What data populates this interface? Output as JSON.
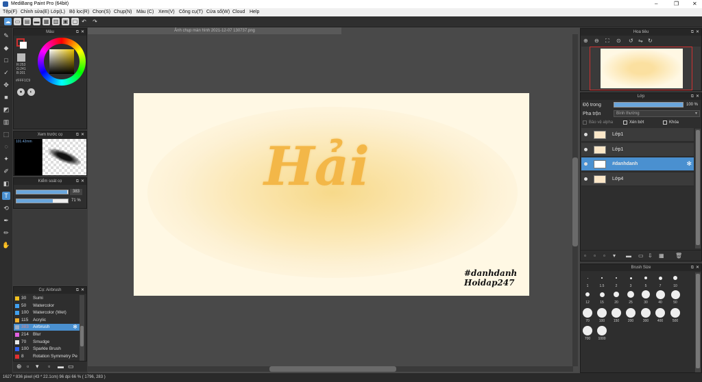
{
  "window": {
    "title": "MediBang Paint Pro (64bit)",
    "controls": [
      "–",
      "❐",
      "✕"
    ]
  },
  "menu": [
    "Tệp(F)",
    "Chỉnh sửa(E)",
    "Lớp(L)",
    "Bộ lọc(R)",
    "Chọn(S)",
    "Chụp(N)",
    "Màu (C)",
    "Xem(V)",
    "Công cụ(T)",
    "Cửa sổ(W)",
    "Cloud",
    "Help"
  ],
  "canvas": {
    "tab_title": "Ảnh chụp màn hình 2021-12-07 130737.png",
    "art_text": "Hải",
    "tag_line1": "#danhdanh",
    "tag_line2": "Hoidap247"
  },
  "color_panel": {
    "title": "Màu",
    "r": "R:253",
    "g": "G:241",
    "b": "B:201",
    "hex": "#FFF1C9",
    "fg": "#f8d9c3",
    "bg": "#ffffff"
  },
  "brush_preview": {
    "title": "Xem trước cọ",
    "size": "101.42mm"
  },
  "brush_control": {
    "title": "Kiểm soát cọ",
    "size_value": "383",
    "opacity_value": "71 %",
    "size_fraction": 0.98,
    "opacity_fraction": 0.71
  },
  "brush_list": {
    "title": "Cọ: Airbrush",
    "items": [
      {
        "size": "30",
        "name": "Sumi",
        "color": "#f0c020"
      },
      {
        "size": "50",
        "name": "Watercolor",
        "color": "#40a0f0"
      },
      {
        "size": "100",
        "name": "Watercolor (Wet)",
        "color": "#40a0f0"
      },
      {
        "size": "115",
        "name": "Acrylic",
        "color": "#f0b030"
      },
      {
        "size": "383",
        "name": "Airbrush",
        "color": "#9fb0c8"
      },
      {
        "size": "214",
        "name": "Blur",
        "color": "#e060e0"
      },
      {
        "size": "70",
        "name": "Smudge",
        "color": "#e8e8e8"
      },
      {
        "size": "100",
        "name": "Sparkle Brush",
        "color": "#3060f0"
      },
      {
        "size": "8",
        "name": "Rotation Symmetry Pe",
        "color": "#e03030"
      }
    ]
  },
  "navigator": {
    "title": "Hoa tiêu"
  },
  "layers": {
    "title": "Lớp",
    "opacity_label": "Độ trong",
    "opacity_value": "100 %",
    "opacity_fraction": 1.0,
    "blend_label": "Pha trộn",
    "blend_value": "Bình thường",
    "protect_alpha": "Bảo vệ alpha",
    "clipping": "Xén bớt",
    "lock": "Khóa",
    "items": [
      {
        "name": "Lớp1",
        "selected": false
      },
      {
        "name": "Lớp1",
        "selected": false
      },
      {
        "name": "#danhdanh",
        "selected": true
      },
      {
        "name": "Lớp4",
        "selected": false
      }
    ]
  },
  "brush_size": {
    "title": "Brush Size",
    "sizes": [
      "1",
      "1.5",
      "2",
      "3",
      "5",
      "7",
      "10",
      "12",
      "15",
      "20",
      "25",
      "30",
      "40",
      "50",
      "70",
      "100",
      "150",
      "200",
      "300",
      "400",
      "500",
      "700",
      "1000"
    ]
  },
  "status": {
    "text": "1627 * 836 pixel  (43 * 22.1cm)  96 dpi  66 %  ( 1796, 283 )"
  }
}
